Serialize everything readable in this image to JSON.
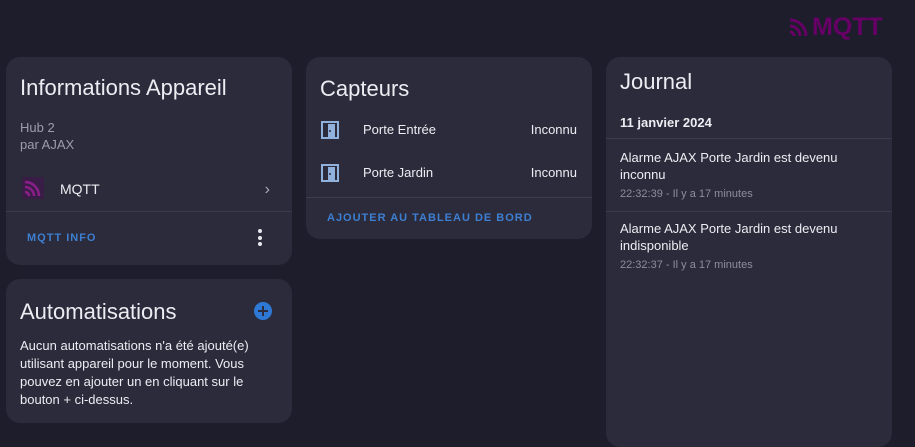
{
  "brand": {
    "logo_text": "MQTT",
    "logo_color": "#660066"
  },
  "device_info": {
    "title": "Informations Appareil",
    "model": "Hub 2",
    "manufacturer": "par AJAX",
    "integration": {
      "label": "MQTT",
      "icon": "mqtt-icon"
    },
    "action_label": "MQTT INFO",
    "menu_icon": "kebab-menu-icon"
  },
  "automations": {
    "title": "Automatisations",
    "add_icon": "plus-circle-icon",
    "description": "Aucun automatisations n'a été ajouté(e) utilisant appareil pour le moment. Vous pouvez en ajouter un en cliquant sur le bouton + ci-dessus."
  },
  "sensors": {
    "title": "Capteurs",
    "items": [
      {
        "name": "Porte Entrée",
        "state": "Inconnu",
        "icon": "door-icon"
      },
      {
        "name": "Porte Jardin",
        "state": "Inconnu",
        "icon": "door-icon"
      }
    ],
    "action_label": "AJOUTER AU TABLEAU DE BORD"
  },
  "logbook": {
    "title": "Journal",
    "date": "11 janvier 2024",
    "entries": [
      {
        "message": "Alarme AJAX Porte Jardin est devenu inconnu",
        "time": "22:32:39 - Il y a 17 minutes"
      },
      {
        "message": "Alarme AJAX Porte Jardin est devenu indisponible",
        "time": "22:32:37 - Il y a 17 minutes"
      }
    ]
  },
  "colors": {
    "background": "#1e1d2b",
    "card": "#2c2b3b",
    "accent": "#3d7fd1",
    "icon_blue": "#8fb1dc"
  }
}
